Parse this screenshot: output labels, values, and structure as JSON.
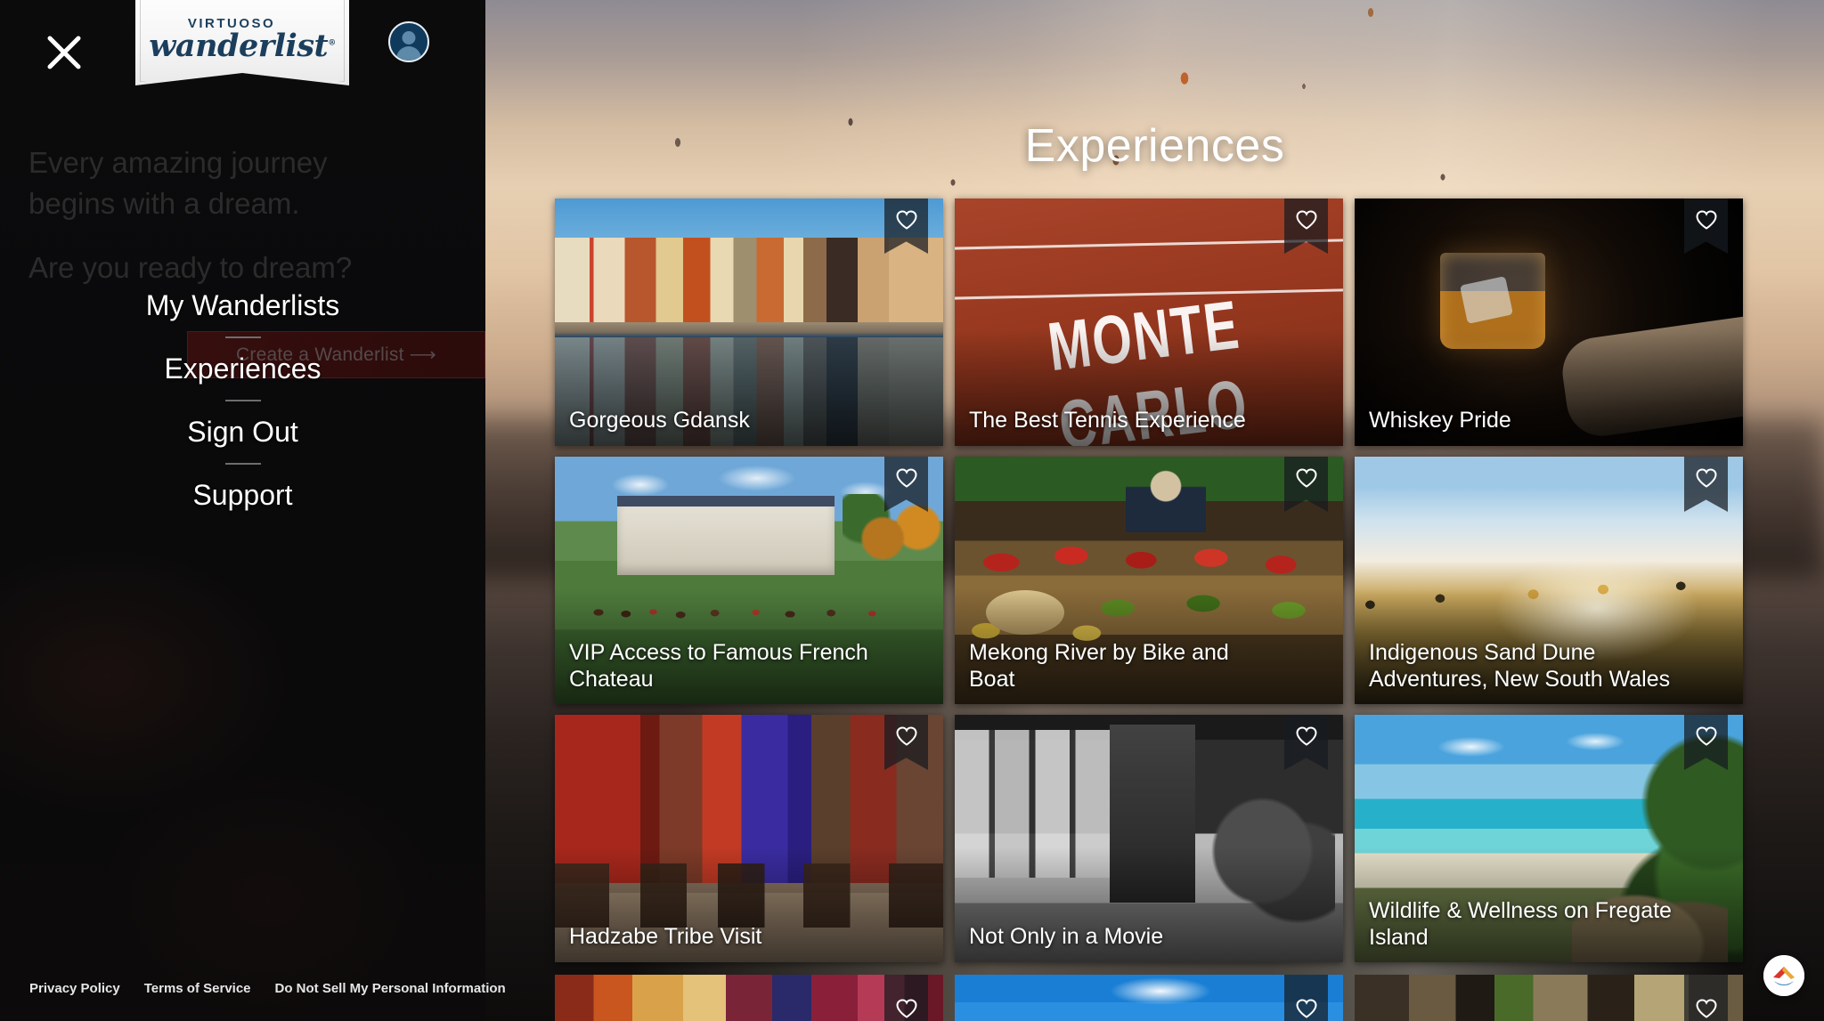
{
  "sidebar": {
    "close_icon": "close-icon",
    "logo": {
      "top_word": "VIRTUOSO",
      "main_word": "wanderlist",
      "registered_mark": "®"
    },
    "avatar_icon": "user-avatar-icon",
    "tagline_line1": "Every amazing journey",
    "tagline_line2": "begins with a dream.",
    "tagline_line3": "Are you ready to dream?",
    "nav": [
      {
        "label": "My Wanderlists"
      },
      {
        "label": "Experiences"
      },
      {
        "label": "Sign Out"
      },
      {
        "label": "Support"
      }
    ],
    "create_wanderlist": {
      "label": "Create a Wanderlist  ⟶",
      "highlight_color": "#3a0e0e"
    },
    "footer": [
      {
        "label": "Privacy Policy"
      },
      {
        "label": "Terms of Service"
      },
      {
        "label": "Do Not Sell My Personal Information"
      }
    ]
  },
  "main": {
    "page_title": "Experiences",
    "favorite_icon": "heart-icon",
    "cards": [
      {
        "title": "Gorgeous Gdansk",
        "photo": "ph-gdansk",
        "favorited": false
      },
      {
        "title": "The Best Tennis Experience",
        "photo": "ph-montecarlo",
        "overlay_text": "MONTE CARLO",
        "favorited": false
      },
      {
        "title": "Whiskey Pride",
        "photo": "ph-whiskey",
        "favorited": false
      },
      {
        "title": "VIP Access to Famous French Chateau",
        "photo": "ph-chateau",
        "favorited": false
      },
      {
        "title": "Mekong River by Bike and Boat",
        "photo": "ph-mekong",
        "favorited": false
      },
      {
        "title": "Indigenous Sand Dune Adventures, New South Wales",
        "photo": "ph-dune",
        "favorited": false
      },
      {
        "title": "Hadzabe Tribe Visit",
        "photo": "ph-hadzabe",
        "favorited": false
      },
      {
        "title": "Not Only in a Movie",
        "photo": "ph-movie",
        "favorited": false
      },
      {
        "title": "Wildlife & Wellness on Fregate Island",
        "photo": "ph-fregate",
        "favorited": false
      }
    ],
    "partial_row": [
      {
        "photo": "ph-p1"
      },
      {
        "photo": "ph-p2"
      },
      {
        "photo": "ph-p3"
      }
    ],
    "fab_icon": "virtuoso-chevron-icon"
  },
  "colors": {
    "sidebar_bg": "#0b0b0c",
    "logo_navy": "#1b3e5d",
    "accent_red": "#d8372c",
    "accent_gold": "#e8a93a",
    "accent_blue": "#3f7fc4",
    "card_overlay": "rgba(22,26,32,0.72)"
  }
}
